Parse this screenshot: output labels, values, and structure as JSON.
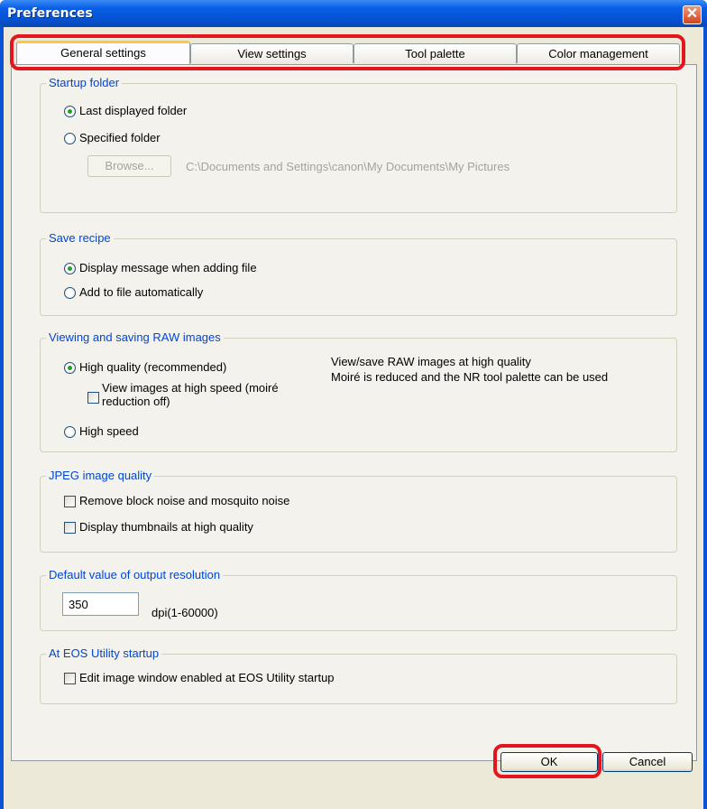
{
  "window": {
    "title": "Preferences",
    "close_glyph": "✕"
  },
  "tabs": [
    {
      "label": "General settings",
      "active": true
    },
    {
      "label": "View settings",
      "active": false
    },
    {
      "label": "Tool palette",
      "active": false
    },
    {
      "label": "Color management",
      "active": false
    }
  ],
  "startup_folder": {
    "title": "Startup folder",
    "option_last": "Last displayed folder",
    "option_specified": "Specified folder",
    "selected": "last",
    "browse_label": "Browse...",
    "path": "C:\\Documents and Settings\\canon\\My Documents\\My Pictures"
  },
  "save_recipe": {
    "title": "Save recipe",
    "option_display": "Display message when adding file",
    "option_auto": "Add to file automatically",
    "selected": "display"
  },
  "raw_images": {
    "title": "Viewing and saving RAW images",
    "option_high_quality": "High quality (recommended)",
    "sub_check_line1": "View images at high speed (moiré",
    "sub_check_line2": "reduction off)",
    "option_high_speed": "High speed",
    "selected": "high_quality",
    "desc_line1": "View/save RAW images at high quality",
    "desc_line2": "Moiré is reduced and the NR tool palette can be used"
  },
  "jpeg_quality": {
    "title": "JPEG image quality",
    "check_noise": "Remove block noise and mosquito noise",
    "check_thumbs": "Display thumbnails at high quality"
  },
  "output_resolution": {
    "title": "Default value of output resolution",
    "value": "350",
    "unit": "dpi(1-60000)"
  },
  "eos_utility": {
    "title": "At EOS Utility startup",
    "check_edit": "Edit image window enabled at EOS Utility startup"
  },
  "buttons": {
    "ok": "OK",
    "cancel": "Cancel"
  },
  "colors": {
    "accent": "#0046d5",
    "highlight": "#e3151e",
    "titlebar": "#0a5ee6"
  }
}
